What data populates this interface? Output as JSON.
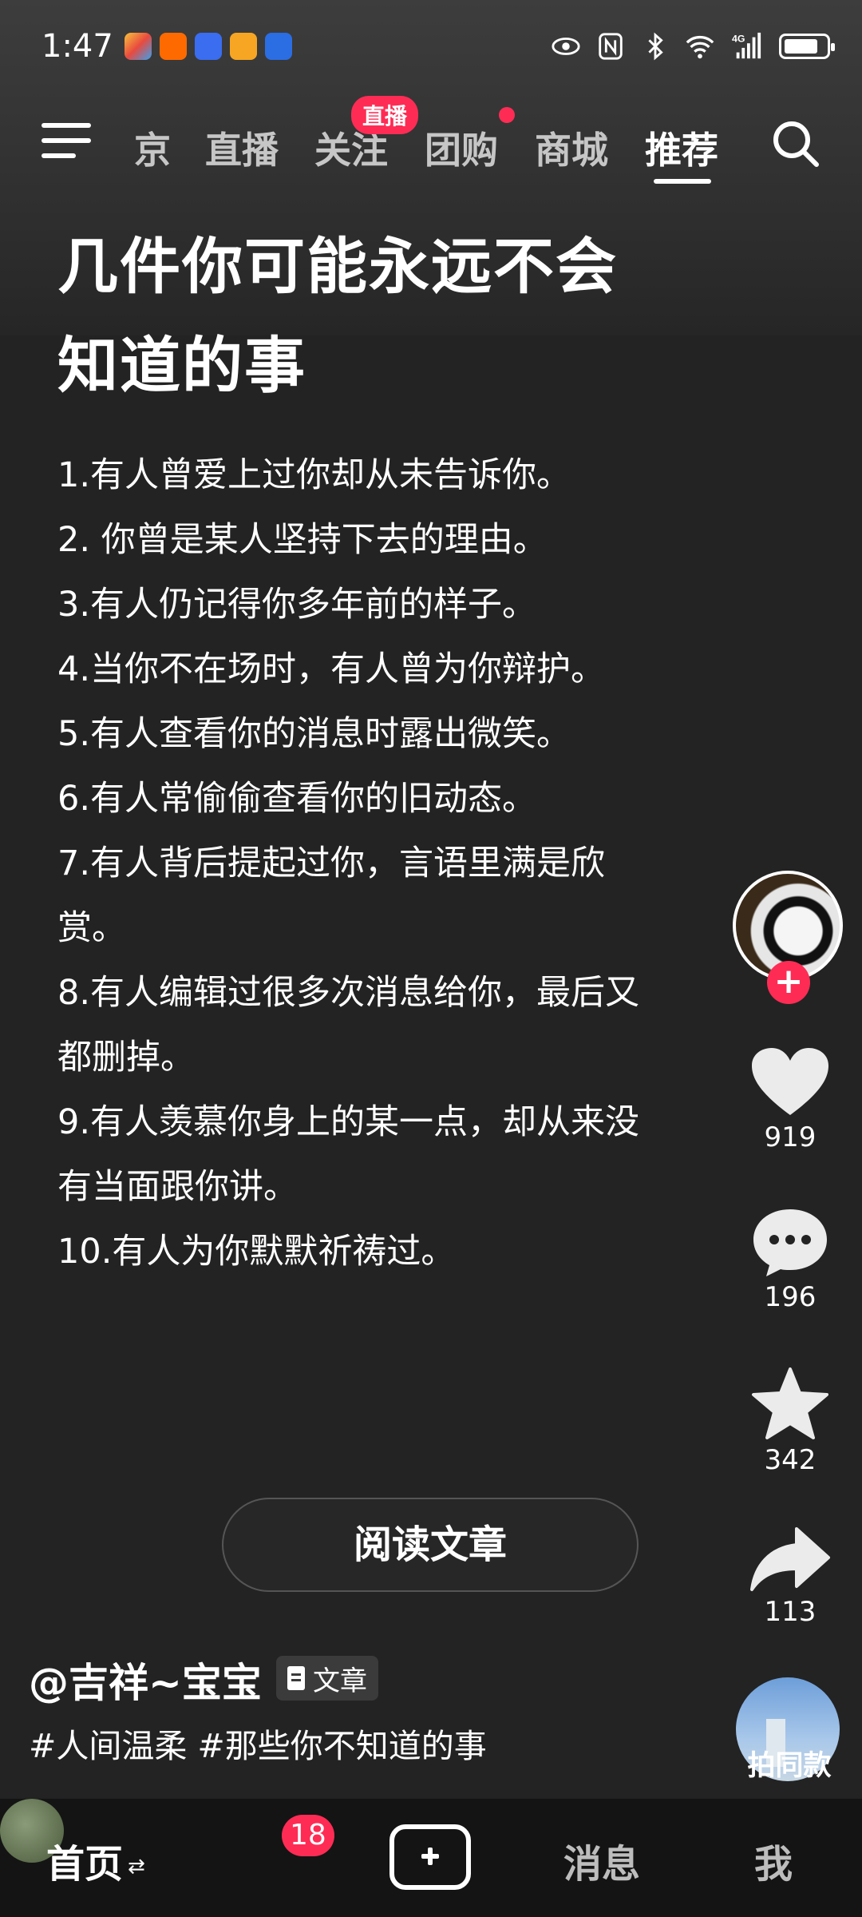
{
  "status_bar": {
    "time": "1:47",
    "network": "4G"
  },
  "top_nav": {
    "tabs": [
      {
        "label": "京",
        "active": false
      },
      {
        "label": "直播",
        "active": false
      },
      {
        "label": "关注",
        "active": false
      },
      {
        "label": "团购",
        "active": false
      },
      {
        "label": "商城",
        "active": false
      },
      {
        "label": "推荐",
        "active": true
      }
    ],
    "live_badge": "直播"
  },
  "post": {
    "title_line1": "几件你可能永远不会",
    "title_line2": "知道的事",
    "items": [
      "1.有人曾爱上过你却从未告诉你。",
      "2. 你曾是某人坚持下去的理由。",
      "3.有人仍记得你多年前的样子。",
      "4.当你不在场时，有人曾为你辩护。",
      "5.有人查看你的消息时露出微笑。",
      "6.有人常偷偷查看你的旧动态。",
      "7.有人背后提起过你，言语里满是欣赏。",
      "8.有人编辑过很多次消息给你，最后又都删掉。",
      "9.有人羡慕你身上的某一点，却从来没有当面跟你讲。",
      "10.有人为你默默祈祷过。"
    ],
    "read_button": "阅读文章",
    "author": "@吉祥~宝宝",
    "type_tag": "文章",
    "hashtags": "#人间温柔 #那些你不知道的事"
  },
  "actions": {
    "likes": "919",
    "comments": "196",
    "favorites": "342",
    "shares": "113",
    "same_style_label": "拍同款"
  },
  "bottom_nav": {
    "home": "首页",
    "friend_badge": "18",
    "messages": "消息",
    "me": "我"
  },
  "colors": {
    "accent": "#fe2c55",
    "background": "#232323",
    "nav_bg": "#141414"
  }
}
